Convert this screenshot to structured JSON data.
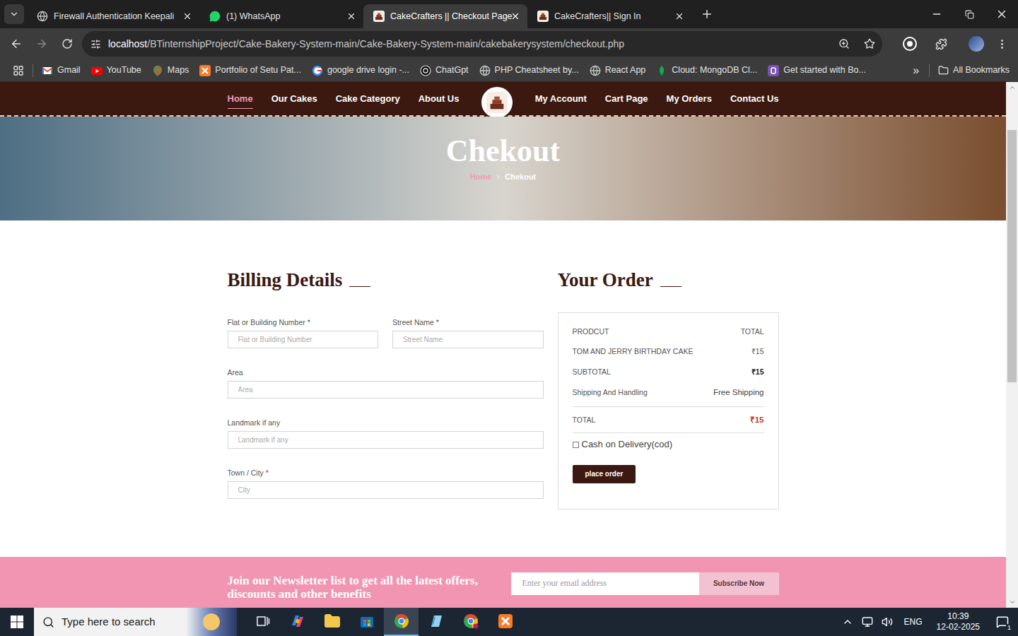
{
  "tabs": [
    {
      "title": "Firewall Authentication Keepali",
      "kind": "globe",
      "selected": false
    },
    {
      "title": "(1) WhatsApp",
      "kind": "whatsapp",
      "selected": false
    },
    {
      "title": "CakeCrafters || Checkout Page",
      "kind": "cake",
      "selected": true
    },
    {
      "title": "CakeCrafters|| Sign In",
      "kind": "cake",
      "selected": false
    }
  ],
  "address_bar": {
    "host": "localhost",
    "path": "/BTinternshipProject/Cake-Bakery-System-main/Cake-Bakery-System-main/cakebakerysystem/checkout.php"
  },
  "bookmarks": [
    {
      "label": "Gmail",
      "kind": "gmail"
    },
    {
      "label": "YouTube",
      "kind": "youtube"
    },
    {
      "label": "Maps",
      "kind": "maps"
    },
    {
      "label": "Portfolio of Setu Pat...",
      "kind": "xampp"
    },
    {
      "label": "google drive login -...",
      "kind": "google"
    },
    {
      "label": "ChatGpt",
      "kind": "chatgpt"
    },
    {
      "label": "PHP Cheatsheet by...",
      "kind": "globe"
    },
    {
      "label": "React App",
      "kind": "globe"
    },
    {
      "label": "Cloud: MongoDB Cl...",
      "kind": "mongodb"
    },
    {
      "label": "Get started with Bo...",
      "kind": "bootstrap"
    }
  ],
  "bookmarks_more": "»",
  "all_bookmarks": "All Bookmarks",
  "page": {
    "nav": {
      "left": [
        {
          "label": "Home",
          "selected": true
        },
        {
          "label": "Our Cakes",
          "selected": false
        },
        {
          "label": "Cake Category",
          "selected": false
        },
        {
          "label": "About Us",
          "selected": false
        }
      ],
      "right": [
        {
          "label": "My Account",
          "selected": false
        },
        {
          "label": "Cart Page",
          "selected": false
        },
        {
          "label": "My Orders",
          "selected": false
        },
        {
          "label": "Contact Us",
          "selected": false
        }
      ]
    },
    "banner": {
      "title": "Chekout",
      "breadcrumb": [
        {
          "label": "Home",
          "selected": false
        },
        {
          "label": "Chekout",
          "selected": true
        }
      ]
    },
    "billing": {
      "title": "Billing Details",
      "rows": [
        [
          {
            "label": "Flat or Building Number *",
            "placeholder": "Flat or Building Number"
          },
          {
            "label": "Street Name *",
            "placeholder": "Street Name"
          }
        ],
        [
          {
            "label": "Area",
            "placeholder": "Area"
          }
        ],
        [
          {
            "label": "Landmark if any",
            "placeholder": "Landmark if any"
          }
        ],
        [
          {
            "label": "Town / City *",
            "placeholder": "City"
          }
        ]
      ]
    },
    "order": {
      "title": "Your Order",
      "header": {
        "product": "PRODCUT",
        "total": "TOTAL"
      },
      "items": [
        {
          "name": "TOM AND JERRY BIRTHDAY CAKE",
          "total": "₹15"
        }
      ],
      "subtotal": {
        "label": "SUBTOTAL",
        "value": "₹15"
      },
      "shipping": {
        "label": "Shipping And Handling",
        "value": "Free Shipping"
      },
      "total": {
        "label": "TOTAL",
        "value": "₹15"
      },
      "payment": {
        "label": "Cash on Delivery(cod)",
        "checked": false
      },
      "button": "place order"
    },
    "newsletter": {
      "text": "Join our Newsletter list to get all the latest offers, discounts and other benefits",
      "placeholder": "Enter your email address",
      "button": "Subscribe Now"
    }
  },
  "scrollbar": {
    "level": 0.48
  },
  "taskbar": {
    "search_placeholder": "Type here to search",
    "apps": [
      {
        "kind": "task-view",
        "active": false
      },
      {
        "kind": "copilot",
        "active": false
      },
      {
        "kind": "explorer",
        "active": false
      },
      {
        "kind": "store",
        "active": false
      },
      {
        "kind": "chrome",
        "active": true
      },
      {
        "kind": "notes",
        "active": false
      },
      {
        "kind": "chrome-profile",
        "active": false
      },
      {
        "kind": "xampp",
        "active": false
      }
    ],
    "tray": {
      "language": "ENG",
      "time": "10:39",
      "date": "12-02-2025",
      "notifications": "1"
    }
  }
}
